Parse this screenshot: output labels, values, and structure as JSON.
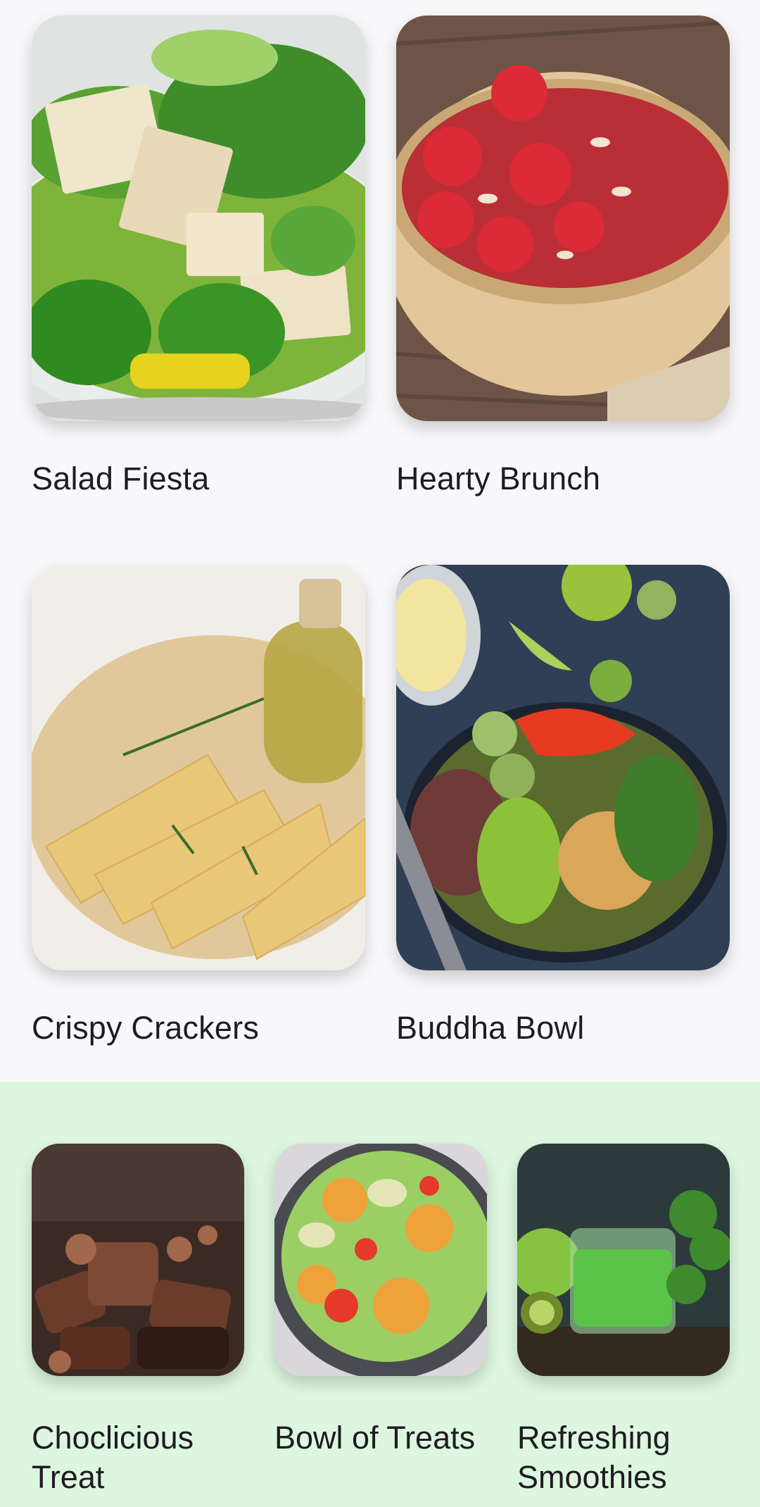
{
  "recipes": [
    {
      "title": "Salad Fiesta",
      "image": "salad-with-tofu-image"
    },
    {
      "title": "Hearty Brunch",
      "image": "strawberry-smoothie-bowl-image"
    },
    {
      "title": "Crispy Crackers",
      "image": "crackers-and-olive-oil-image"
    },
    {
      "title": "Buddha Bowl",
      "image": "buddha-bowl-image"
    }
  ],
  "featured": [
    {
      "title": "Choclicious Treat",
      "image": "chocolates-image"
    },
    {
      "title": "Bowl of Treats",
      "image": "citrus-salad-bowl-image"
    },
    {
      "title": "Refreshing Smoothies",
      "image": "green-smoothie-image"
    }
  ],
  "colors": {
    "background": "#f8f8fa",
    "featured_background": "#dcf6df",
    "text": "#1f1b20"
  }
}
